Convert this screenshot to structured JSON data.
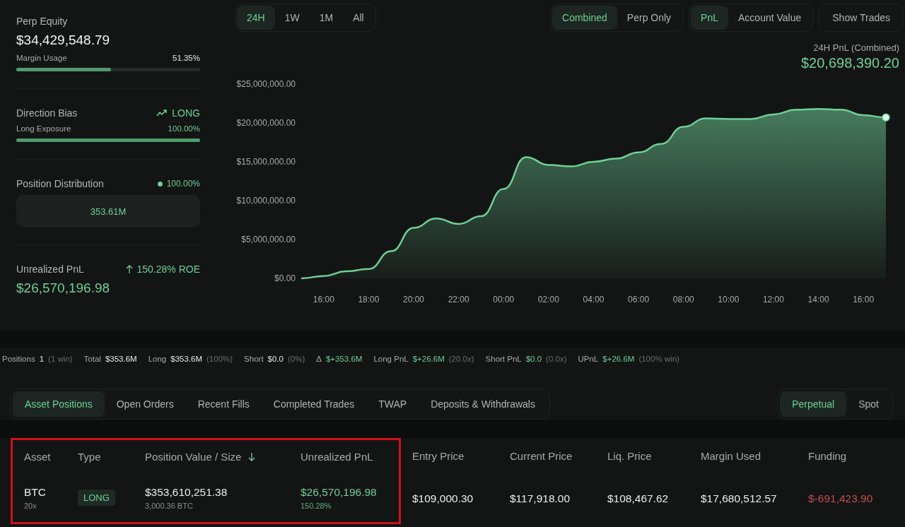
{
  "summary": {
    "equity": {
      "label": "Perp Equity",
      "value": "$34,429,548.79",
      "usage_label": "Margin Usage",
      "usage_value": "51.35%",
      "level": 0.5135
    },
    "direction": {
      "label": "Direction Bias",
      "value": "LONG",
      "exposure_label": "Long Exposure",
      "exposure_value": "100.00%",
      "level": 1.0
    },
    "distribution": {
      "label": "Position Distribution",
      "share": "100.00%",
      "amount": "353.61M"
    },
    "unrealized": {
      "label": "Unrealized PnL",
      "roe": "150.28% ROE",
      "value": "$26,570,196.98"
    }
  },
  "range_tabs": [
    {
      "label": "24H",
      "selected": true
    },
    {
      "label": "1W",
      "selected": false
    },
    {
      "label": "1M",
      "selected": false
    },
    {
      "label": "All",
      "selected": false
    }
  ],
  "mode_tabs": [
    {
      "label": "Combined",
      "selected": true
    },
    {
      "label": "Perp Only",
      "selected": false
    }
  ],
  "metric_tabs": [
    {
      "label": "PnL",
      "selected": true
    },
    {
      "label": "Account Value",
      "selected": false
    }
  ],
  "show_trades": "Show Trades",
  "chart_header": {
    "label": "24H PnL (Combined)",
    "value": "$20,698,390.20"
  },
  "chart_data": {
    "type": "area",
    "categories": [
      null,
      "16:00",
      null,
      "18:00",
      null,
      "20:00",
      null,
      "22:00",
      null,
      "00:00",
      null,
      "02:00",
      null,
      "04:00",
      null,
      "06:00",
      null,
      "08:00",
      null,
      "10:00",
      null,
      "12:00",
      null,
      "14:00",
      null,
      "16:00",
      null
    ],
    "series": [
      {
        "color": "#6fcf97",
        "values": [
          0,
          300000,
          900000,
          1200000,
          3500000,
          6500000,
          7700000,
          7000000,
          8000000,
          11500000,
          15600000,
          14600000,
          14400000,
          15000000,
          15400000,
          16200000,
          17300000,
          19500000,
          20600000,
          20500000,
          20500000,
          21100000,
          21700000,
          21800000,
          21700000,
          21000000,
          20700000
        ]
      }
    ],
    "ylim": [
      0,
      25000000
    ],
    "yticks": [
      {
        "value": 0,
        "label": "$0.00"
      },
      {
        "value": 5000000,
        "label": "$5,000,000.00"
      },
      {
        "value": 10000000,
        "label": "$10,000,000.00"
      },
      {
        "value": 15000000,
        "label": "$15,000,000.00"
      },
      {
        "value": 20000000,
        "label": "$20,000,000.00"
      },
      {
        "value": 25000000,
        "label": "$25,000,000.00"
      }
    ]
  },
  "stats": [
    {
      "label": "Positions",
      "value": "1",
      "note": "(1 win)",
      "positive": false
    },
    {
      "label": "Total",
      "value": "$353.6M",
      "positive": false
    },
    {
      "label": "Long",
      "value": "$353.6M",
      "note": "(100%)",
      "positive": false
    },
    {
      "label": "Short",
      "value": "$0.0",
      "note": "(0%)",
      "positive": false
    },
    {
      "label": "Δ",
      "value": "$+353.6M",
      "positive": true
    },
    {
      "label": "Long PnL",
      "value": "$+26.6M",
      "note": "(20.0x)",
      "positive": true
    },
    {
      "label": "Short PnL",
      "value": "$0.0",
      "note": "(0.0x)",
      "positive": true
    },
    {
      "label": "UPnL",
      "value": "$+26.6M",
      "note": "(100% win)",
      "positive": true
    }
  ],
  "section_tabs": [
    {
      "label": "Asset Positions",
      "selected": true
    },
    {
      "label": "Open Orders",
      "selected": false
    },
    {
      "label": "Recent Fills",
      "selected": false
    },
    {
      "label": "Completed Trades",
      "selected": false
    },
    {
      "label": "TWAP",
      "selected": false
    },
    {
      "label": "Deposits & Withdrawals",
      "selected": false
    }
  ],
  "market_tabs": [
    {
      "label": "Perpetual",
      "selected": true
    },
    {
      "label": "Spot",
      "selected": false
    }
  ],
  "table": {
    "columns": [
      {
        "label": "Asset",
        "highlighted": true,
        "sorted": false
      },
      {
        "label": "Type",
        "highlighted": true,
        "sorted": false
      },
      {
        "label": "Position Value / Size",
        "highlighted": true,
        "sorted": true
      },
      {
        "label": "Unrealized PnL",
        "highlighted": true,
        "sorted": false
      },
      {
        "label": "Entry Price",
        "highlighted": false,
        "sorted": false
      },
      {
        "label": "Current Price",
        "highlighted": false,
        "sorted": false
      },
      {
        "label": "Liq. Price",
        "highlighted": false,
        "sorted": false
      },
      {
        "label": "Margin Used",
        "highlighted": false,
        "sorted": false
      },
      {
        "label": "Funding",
        "highlighted": false,
        "sorted": false
      }
    ],
    "rows": [
      {
        "cells": [
          {
            "kind": "stack",
            "positive": false,
            "negative": false,
            "value": "BTC",
            "sub": "20x"
          },
          {
            "kind": "badge",
            "positive": true,
            "negative": false,
            "value": "LONG"
          },
          {
            "kind": "stack",
            "positive": false,
            "negative": false,
            "value": "$353,610,251.38",
            "sub": "3,000.36 BTC"
          },
          {
            "kind": "stack",
            "positive": true,
            "negative": false,
            "value": "$26,570,196.98",
            "sub": "150.28%"
          },
          {
            "kind": "plain",
            "positive": false,
            "negative": false,
            "value": "$109,000.30"
          },
          {
            "kind": "plain",
            "positive": false,
            "negative": false,
            "value": "$117,918.00"
          },
          {
            "kind": "plain",
            "positive": false,
            "negative": false,
            "value": "$108,467.62"
          },
          {
            "kind": "plain",
            "positive": false,
            "negative": false,
            "value": "$17,680,512.57"
          },
          {
            "kind": "plain",
            "positive": false,
            "negative": true,
            "value": "$-691,423.90"
          }
        ]
      }
    ]
  }
}
